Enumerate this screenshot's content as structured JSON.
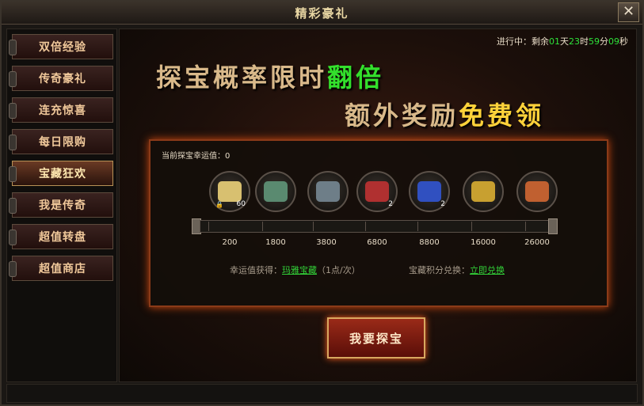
{
  "window": {
    "title": "精彩豪礼",
    "close_label": "✕"
  },
  "sidebar": {
    "items": [
      {
        "label": "双倍经验",
        "active": false
      },
      {
        "label": "传奇豪礼",
        "active": false
      },
      {
        "label": "连充惊喜",
        "active": false
      },
      {
        "label": "每日限购",
        "active": false
      },
      {
        "label": "宝藏狂欢",
        "active": true
      },
      {
        "label": "我是传奇",
        "active": false
      },
      {
        "label": "超值转盘",
        "active": false
      },
      {
        "label": "超值商店",
        "active": false
      }
    ]
  },
  "timer": {
    "prefix": "进行中：剩余",
    "days": "01",
    "day_unit": "天",
    "hours": "23",
    "hour_unit": "时",
    "minutes": "59",
    "minute_unit": "分",
    "seconds": "09",
    "second_unit": "秒"
  },
  "banner": {
    "line1": "探宝概率限时",
    "line1_highlight": "翻倍",
    "line2": "额外奖励",
    "line2_highlight": "免费领"
  },
  "panel": {
    "luck_label": "当前探宝幸运值：",
    "luck_value": "0",
    "rewards": [
      {
        "icon": "scroll-icon",
        "count": "60",
        "lock": "🔒",
        "color": "#d8c070"
      },
      {
        "icon": "chest-icon",
        "count": "",
        "color": "#5a8a70"
      },
      {
        "icon": "chest-icon",
        "count": "",
        "color": "#6e7e88"
      },
      {
        "icon": "chest-icon",
        "count": "2",
        "color": "#b03030"
      },
      {
        "icon": "chest-icon",
        "count": "2",
        "color": "#3050c0"
      },
      {
        "icon": "chest-icon",
        "count": "",
        "color": "#c8a030"
      },
      {
        "icon": "chest-icon",
        "count": "",
        "color": "#c06030"
      }
    ],
    "milestones": [
      "200",
      "1800",
      "3800",
      "6800",
      "8800",
      "16000",
      "26000"
    ],
    "obtain_label": "幸运值获得：",
    "obtain_link": "玛雅宝藏",
    "obtain_rate": "（1点/次）",
    "exchange_label": "宝藏积分兑换：",
    "exchange_link": "立即兑换"
  },
  "action_button": "我要探宝"
}
